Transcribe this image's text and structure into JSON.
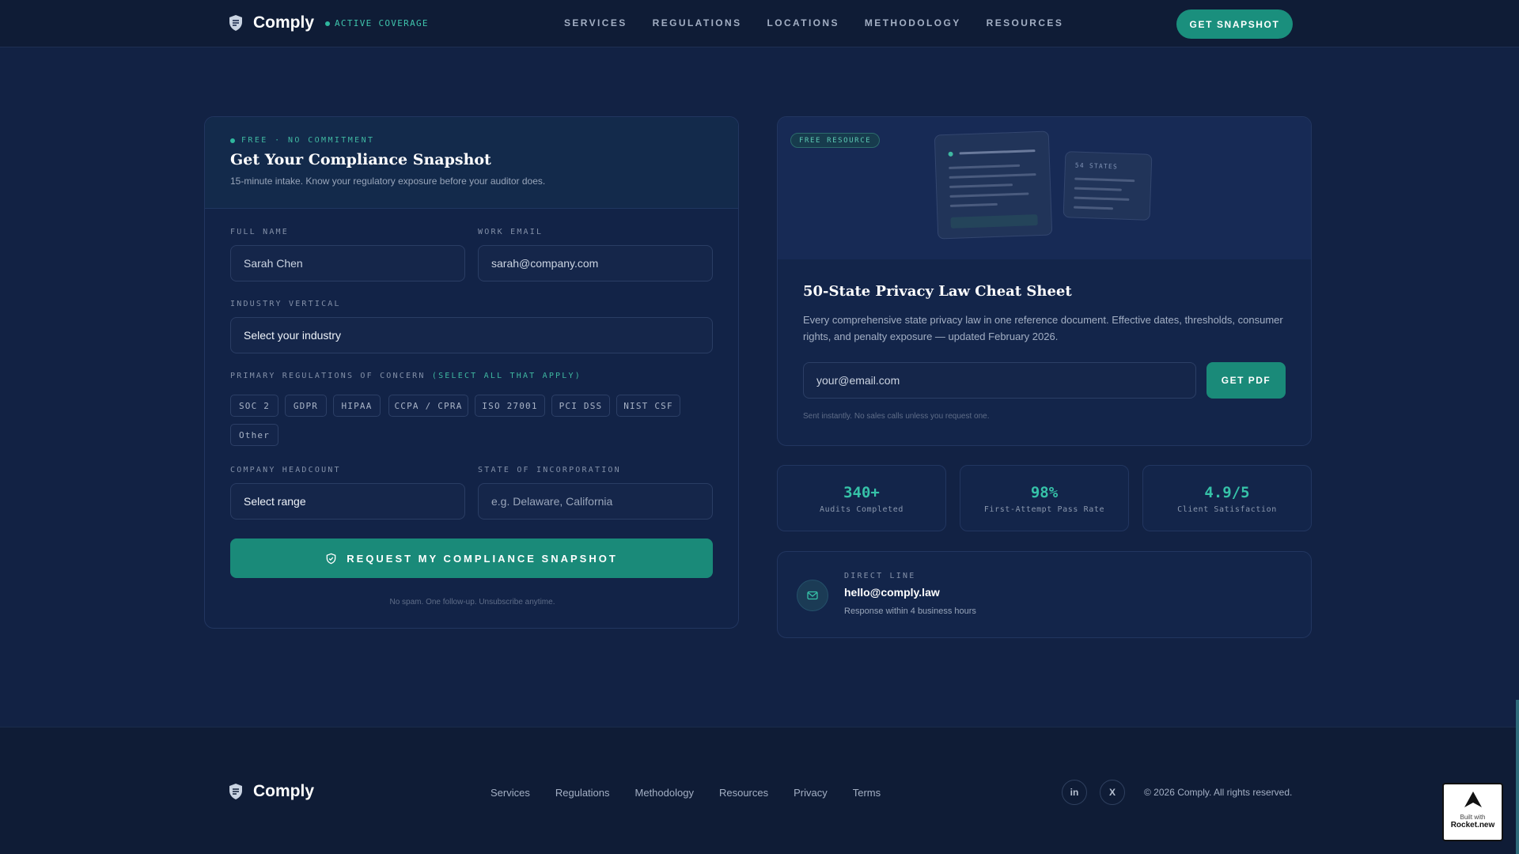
{
  "header": {
    "brand": "Comply",
    "coverage": "ACTIVE COVERAGE",
    "nav": [
      "SERVICES",
      "REGULATIONS",
      "LOCATIONS",
      "METHODOLOGY",
      "RESOURCES"
    ],
    "cta": "GET SNAPSHOT"
  },
  "form": {
    "eyebrow": "FREE · NO COMMITMENT",
    "title": "Get Your Compliance Snapshot",
    "subtitle": "15-minute intake. Know your regulatory exposure before your auditor does.",
    "full_name_label": "FULL NAME",
    "full_name_value": "Sarah Chen",
    "email_label": "WORK EMAIL",
    "email_value": "sarah@company.com",
    "industry_label": "INDUSTRY VERTICAL",
    "industry_value": "Select your industry",
    "regs_label": "PRIMARY REGULATIONS OF CONCERN",
    "regs_hint": "(SELECT ALL THAT APPLY)",
    "regs": [
      "SOC 2",
      "GDPR",
      "HIPAA",
      "CCPA / CPRA",
      "ISO 27001",
      "PCI DSS",
      "NIST CSF",
      "Other"
    ],
    "headcount_label": "COMPANY HEADCOUNT",
    "headcount_value": "Select range",
    "state_label": "STATE OF INCORPORATION",
    "state_placeholder": "e.g. Delaware, California",
    "submit": "REQUEST MY COMPLIANCE SNAPSHOT",
    "fine_print": "No spam. One follow-up. Unsubscribe anytime."
  },
  "resource": {
    "badge": "FREE RESOURCE",
    "doc_label": "54 STATES",
    "title": "50-State Privacy Law Cheat Sheet",
    "description": "Every comprehensive state privacy law in one reference document. Effective dates, thresholds, consumer rights, and penalty exposure — updated February 2026.",
    "email_placeholder": "your@email.com",
    "cta": "GET PDF",
    "fine_print": "Sent instantly. No sales calls unless you request one."
  },
  "stats": [
    {
      "value": "340+",
      "label": "Audits Completed"
    },
    {
      "value": "98%",
      "label": "First-Attempt Pass Rate"
    },
    {
      "value": "4.9/5",
      "label": "Client Satisfaction"
    }
  ],
  "direct": {
    "label": "DIRECT LINE",
    "email": "hello@comply.law",
    "response": "Response within 4 business hours"
  },
  "footer": {
    "brand": "Comply",
    "links": [
      "Services",
      "Regulations",
      "Methodology",
      "Resources",
      "Privacy",
      "Terms"
    ],
    "social": [
      "in",
      "X"
    ],
    "copyright": "© 2026 Comply. All rights reserved."
  },
  "badge_builder": {
    "line1": "Built with",
    "line2": "Rocket.new"
  },
  "colors": {
    "accent": "#1a8a79",
    "accent_text": "#36c2a8",
    "background": "#122244"
  }
}
